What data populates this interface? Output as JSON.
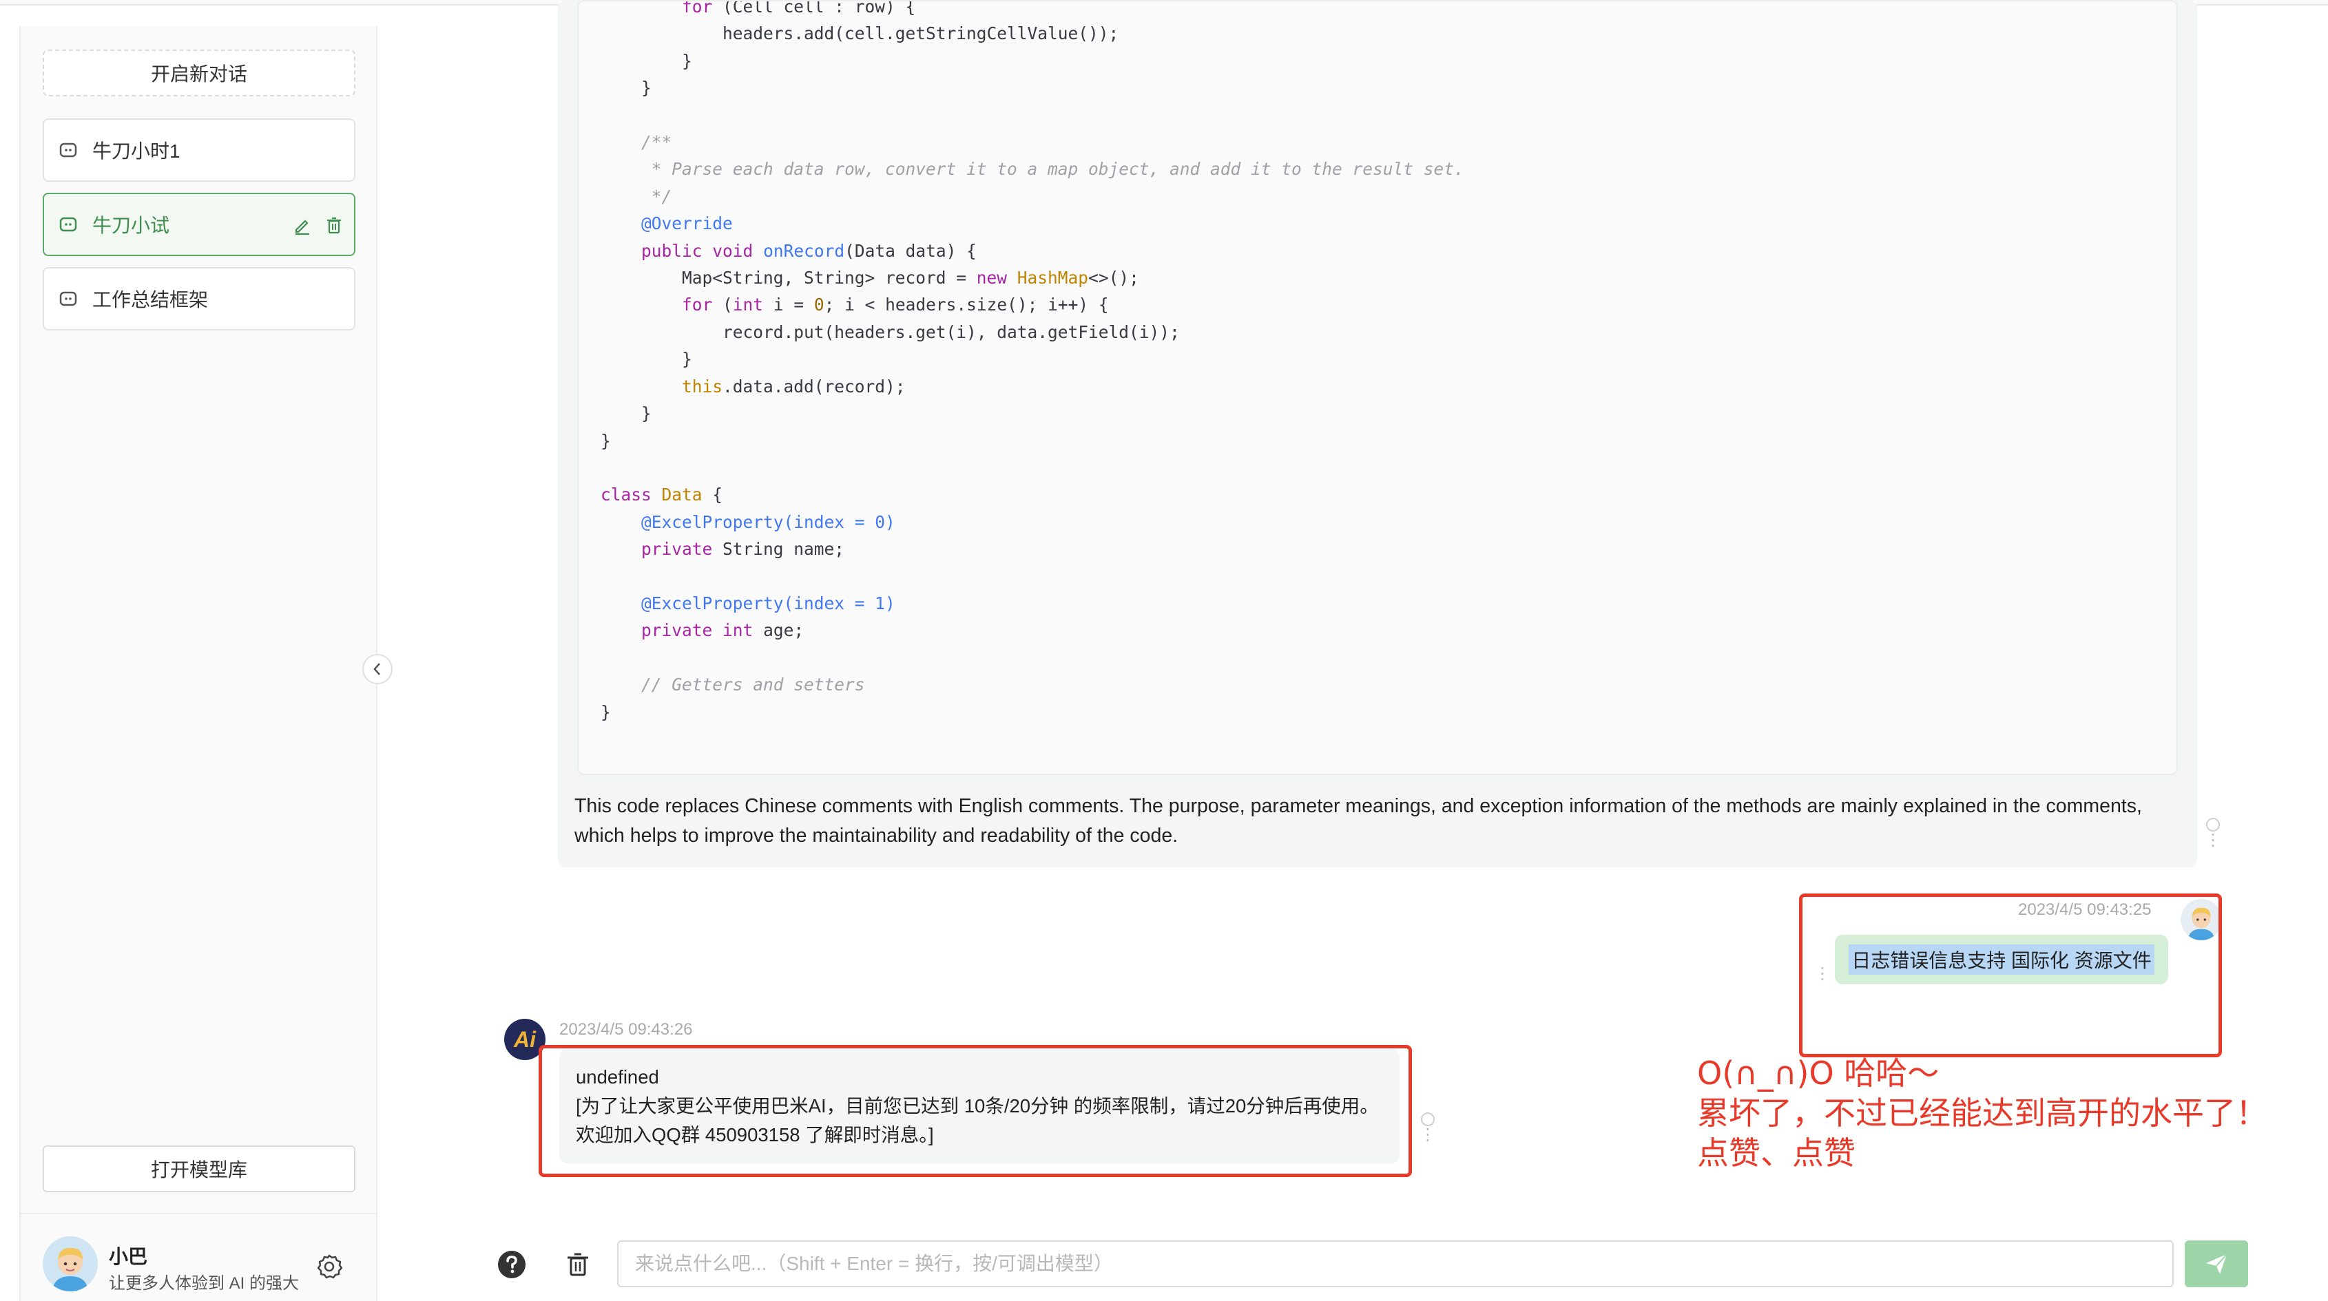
{
  "sidebar": {
    "new_chat_label": "开启新对话",
    "conversations": [
      {
        "title": "牛刀小时1",
        "active": false
      },
      {
        "title": "牛刀小试",
        "active": true
      },
      {
        "title": "工作总结框架",
        "active": false
      }
    ],
    "model_library_label": "打开模型库",
    "user": {
      "name": "小巴",
      "description": "让更多人体验到 AI 的强大"
    }
  },
  "messages": {
    "code_explanation": "This code replaces Chinese comments with English comments. The purpose, parameter meanings, and exception information of the methods are mainly explained in the comments, which helps to improve the maintainability and readability of the code.",
    "user_message": {
      "time": "2023/4/5 09:43:25",
      "text": "日志错误信息支持 国际化 资源文件"
    },
    "ai_message": {
      "time": "2023/4/5 09:43:26",
      "avatar_text": "Ai",
      "line1": "undefined",
      "line2": "[为了让大家更公平使用巴米AI，目前您已达到 10条/20分钟 的频率限制，请过20分钟后再使用。",
      "line3": "欢迎加入QQ群 450903158 了解即时消息。]"
    }
  },
  "annotation": {
    "line1": "O(∩_∩)O 哈哈～",
    "line2": "累坏了，不过已经能达到高开的水平了！",
    "line3": "点赞、点赞",
    "color": "#e83a2a"
  },
  "composer": {
    "placeholder": "来说点什么吧...（Shift + Enter = 换行，按/可调出模型）"
  },
  "colors": {
    "accent": "#5aa86a",
    "send_button": "#9dd4a8"
  }
}
